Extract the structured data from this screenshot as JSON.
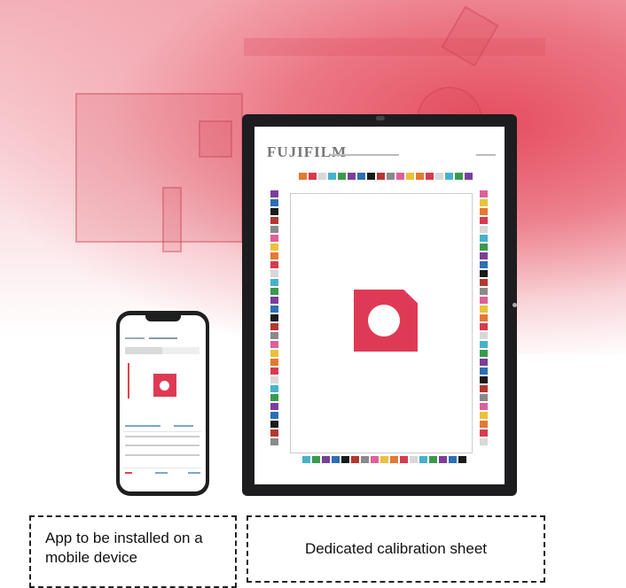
{
  "tablet": {
    "logo": "FUJIFILM"
  },
  "captions": {
    "mobile_app": "App to be installed on a mobile device",
    "calibration_sheet": "Dedicated calibration sheet"
  },
  "colors": {
    "accent": "#df3a55",
    "background_gradient": "#e4465a",
    "device_frame": "#1d1d1f"
  },
  "icons": [
    "smartphone",
    "tablet",
    "color-calibration-chart",
    "sample-part"
  ]
}
